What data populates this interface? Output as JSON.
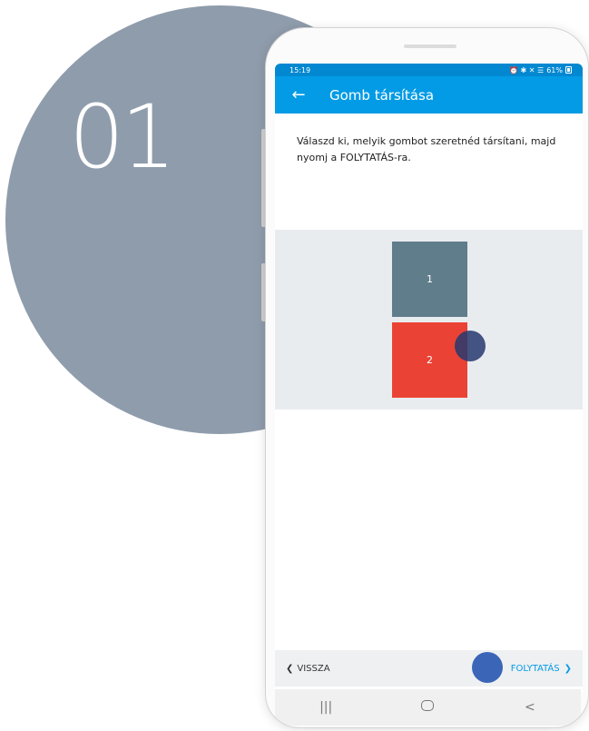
{
  "step": {
    "number": "01"
  },
  "status_bar": {
    "time": "15:19",
    "icons": "⏰ ✱ ✕ ☰",
    "battery": "61%"
  },
  "app_bar": {
    "back_icon": "arrow-left-icon",
    "title": "Gomb társítása"
  },
  "instruction": "Válaszd ki, melyik gombot szeretnéd társítani, majd nyomj a FOLYTATÁS-ra.",
  "options": [
    {
      "label": "1",
      "color": "#607d8b"
    },
    {
      "label": "2",
      "color": "#ea4335"
    }
  ],
  "bottom_bar": {
    "back_label": "VISSZA",
    "continue_label": "FOLYTATÁS"
  },
  "nav": {
    "recents": "|||",
    "home": "home",
    "back": "<"
  },
  "colors": {
    "accent": "#039be5",
    "background_circle": "#8f9cac",
    "tap_indicator": "#3b66b8"
  }
}
